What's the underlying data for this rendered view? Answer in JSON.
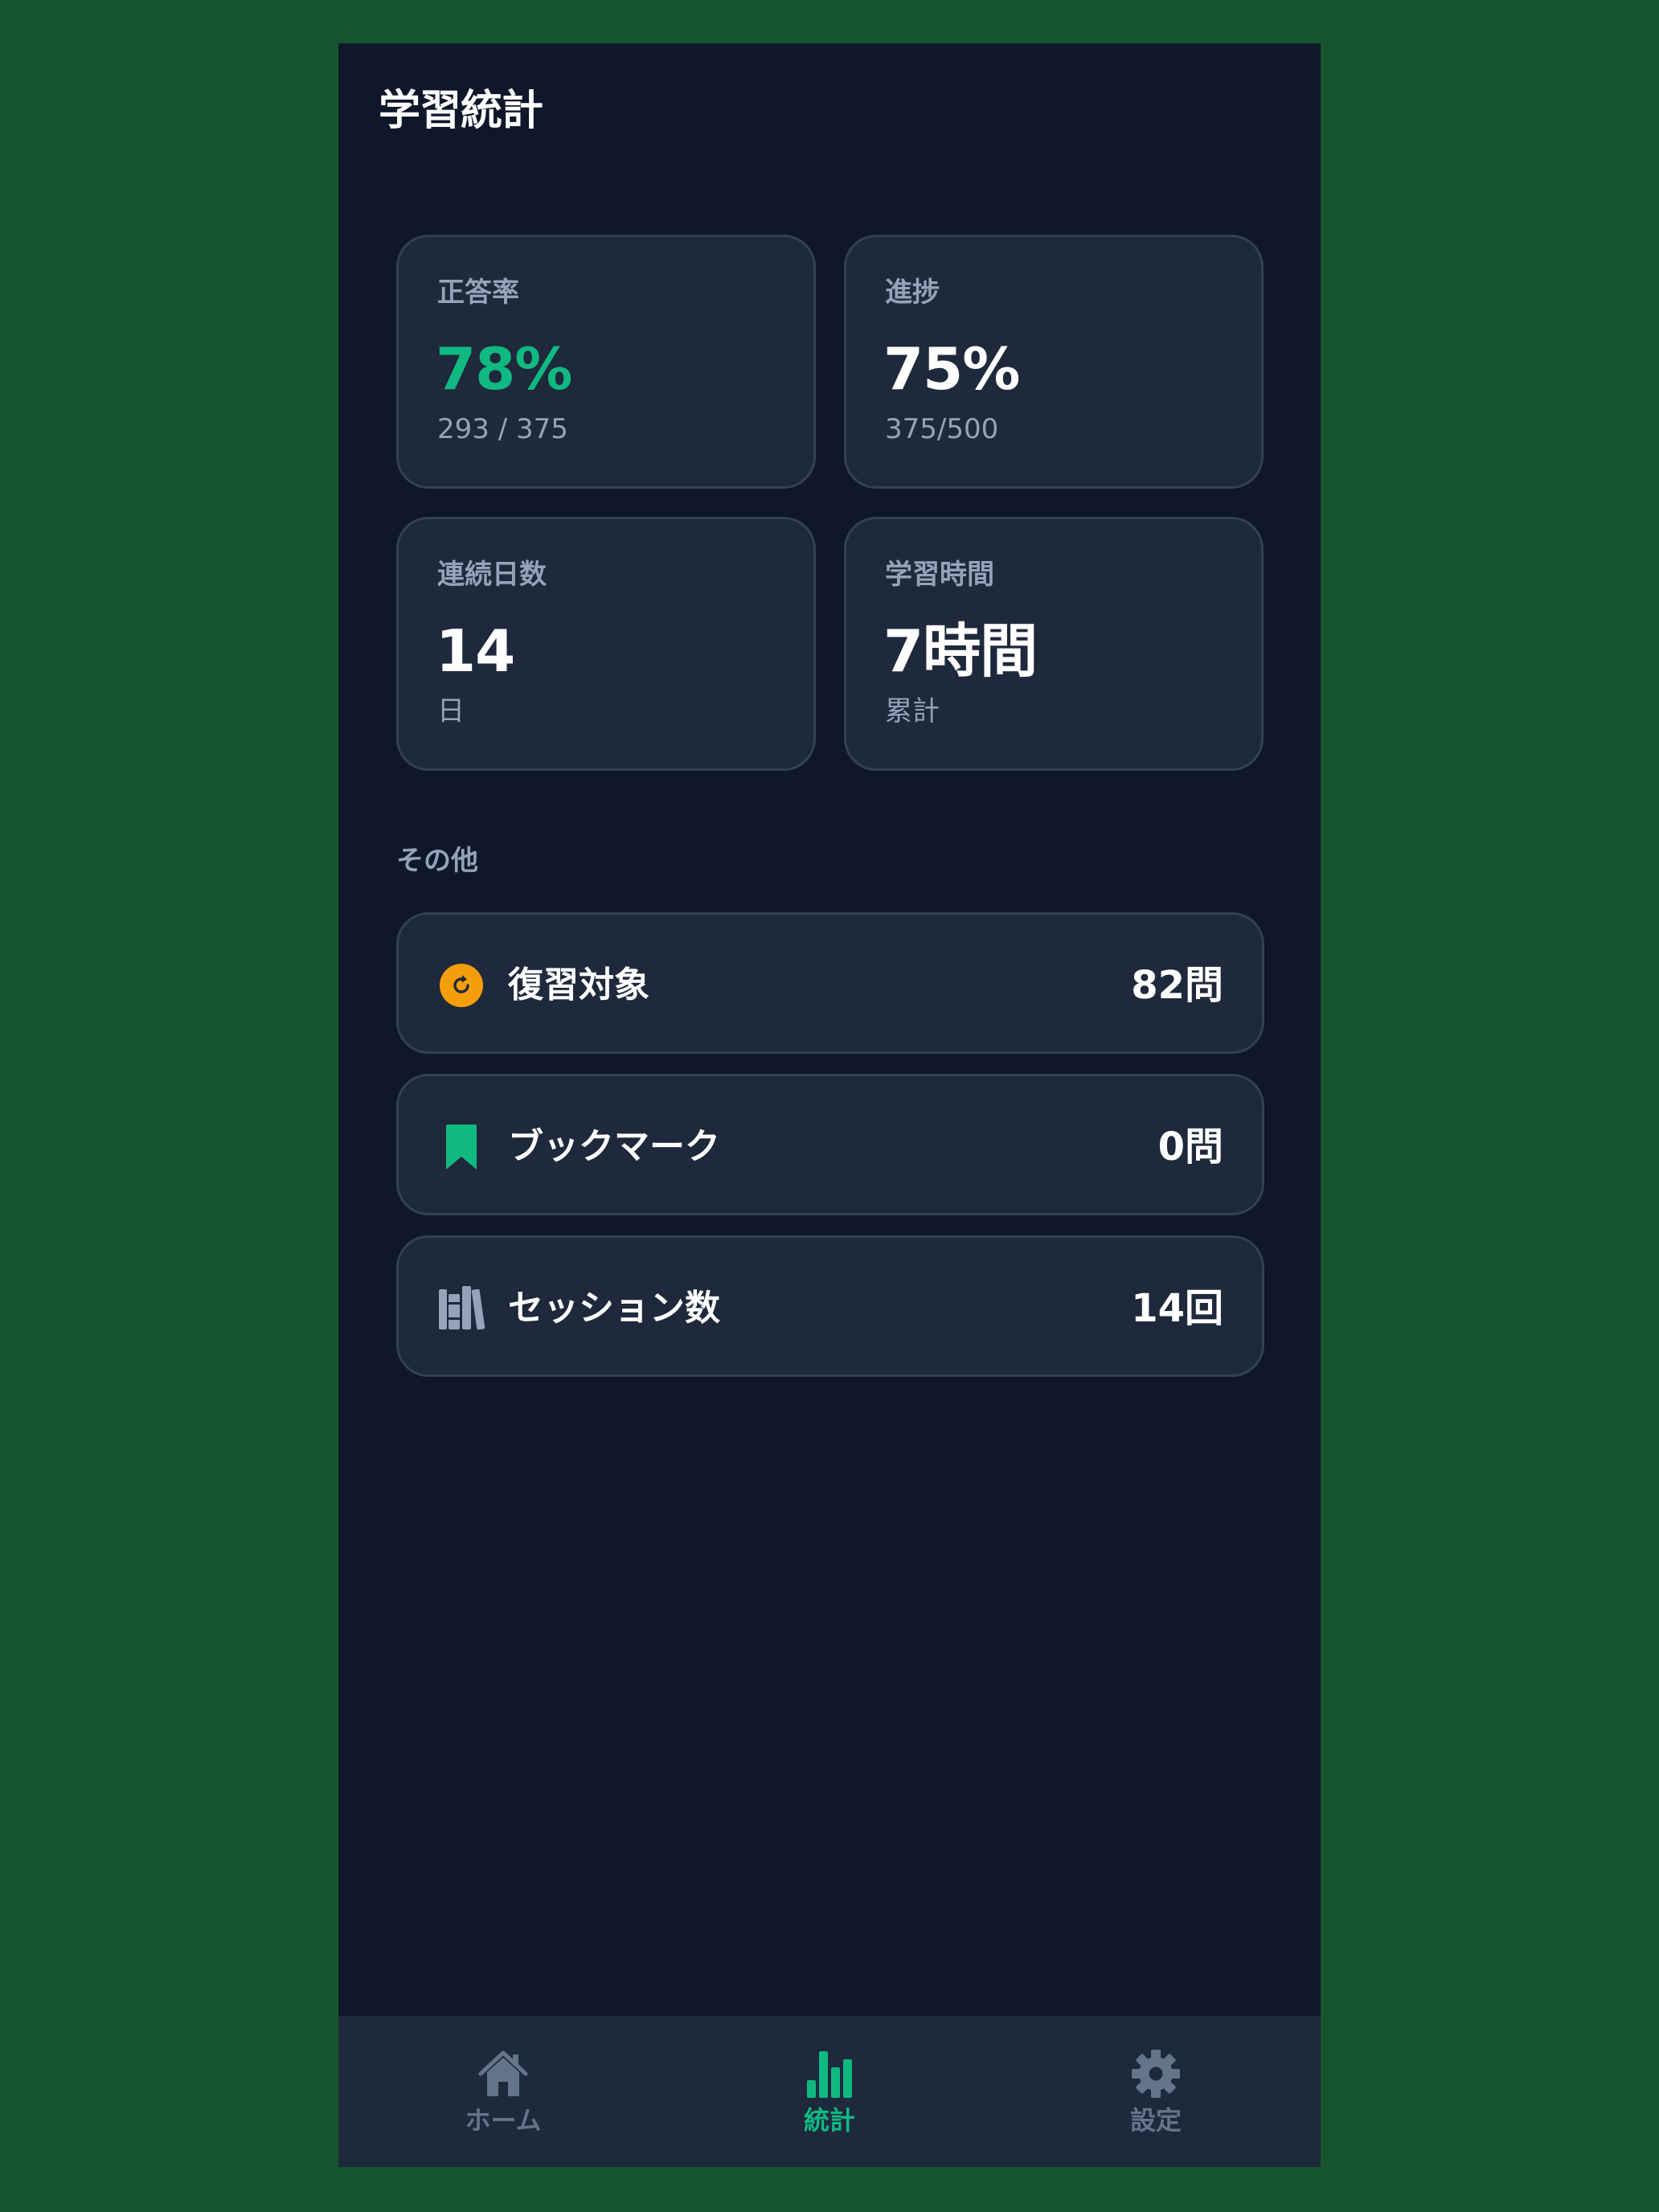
{
  "header": {
    "title": "学習統計"
  },
  "stats": [
    {
      "label": "正答率",
      "value": "78%",
      "sub": "293 / 375"
    },
    {
      "label": "進捗",
      "value": "75%",
      "sub": "375/500"
    },
    {
      "label": "連続日数",
      "value": "14",
      "sub": "日"
    },
    {
      "label": "学習時間",
      "value": "7時間",
      "sub": "累計"
    }
  ],
  "others": {
    "title": "その他",
    "items": [
      {
        "icon": "review-refresh-icon",
        "label": "復習対象",
        "value": "82問"
      },
      {
        "icon": "bookmark-icon",
        "label": "ブックマーク",
        "value": "0問"
      },
      {
        "icon": "books-icon",
        "label": "セッション数",
        "value": "14回"
      }
    ]
  },
  "tabbar": {
    "items": [
      {
        "icon": "home-icon",
        "label": "ホーム"
      },
      {
        "icon": "bar-chart-icon",
        "label": "統計",
        "active": true
      },
      {
        "icon": "gear-icon",
        "label": "設定"
      }
    ]
  },
  "colors": {
    "background": "#16552f",
    "screen": "#0f172a",
    "card": "#1e293b",
    "accent_green": "#10b981",
    "accent_orange": "#f59e0b",
    "muted": "#94a3b8"
  }
}
